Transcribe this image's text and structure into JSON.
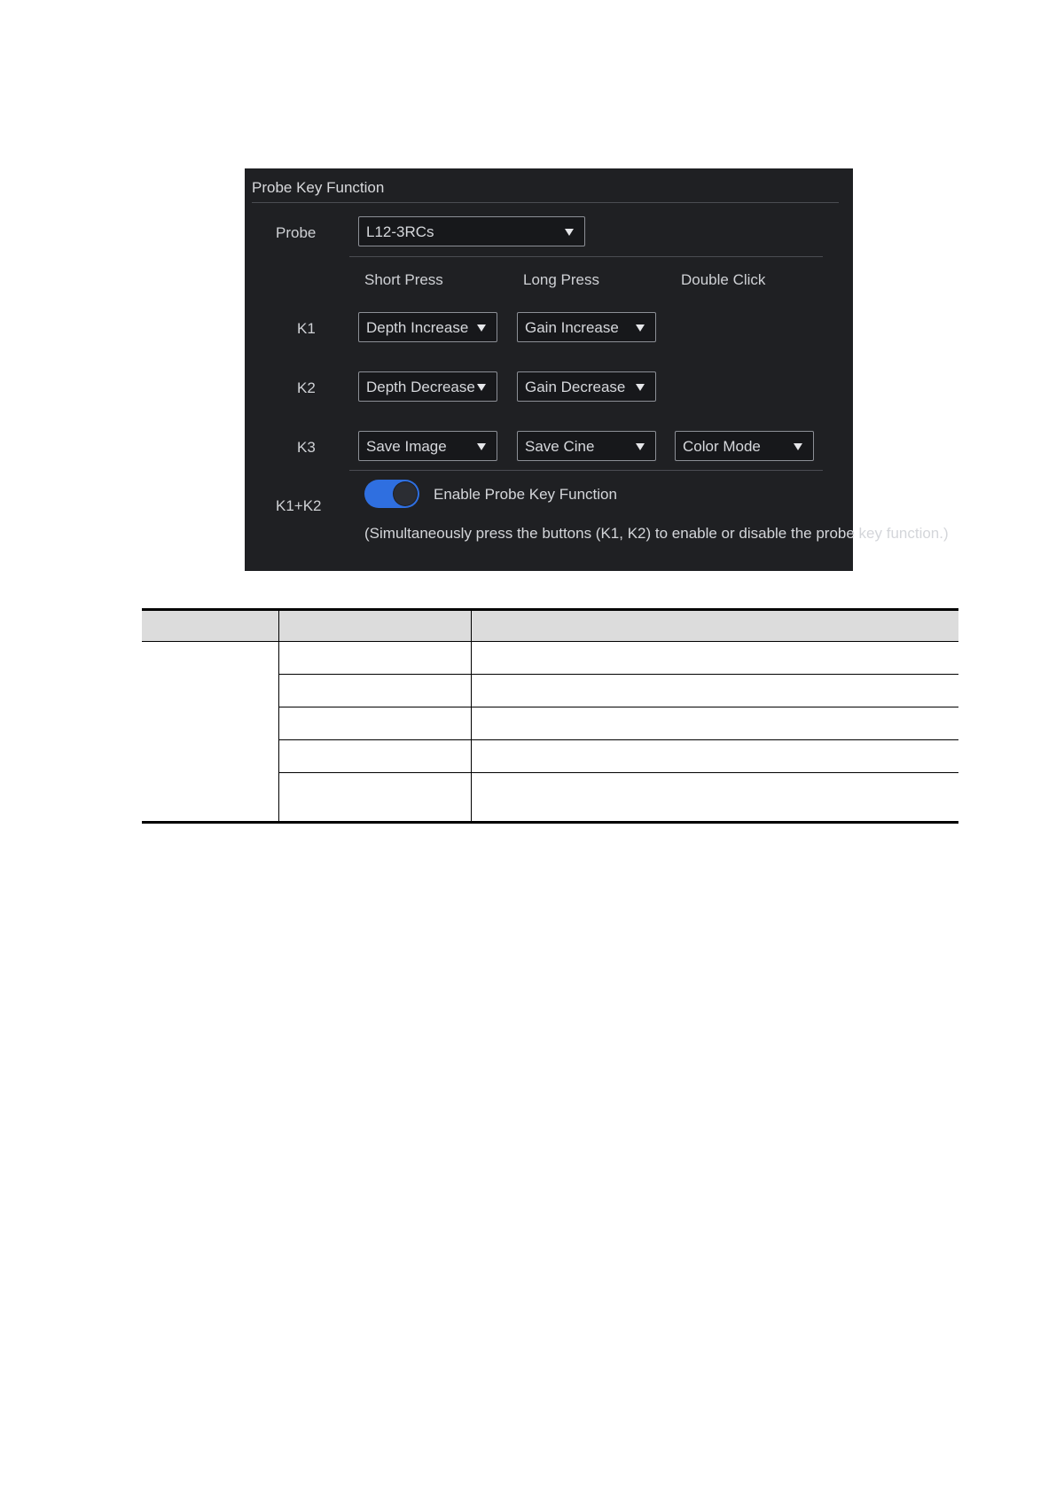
{
  "panel": {
    "title": "Probe Key Function",
    "probe": {
      "label": "Probe",
      "value": "L12-3RCs"
    },
    "columns": {
      "short": "Short Press",
      "long": "Long Press",
      "double": "Double Click"
    },
    "rows": [
      {
        "key": "K1",
        "short": "Depth Increase",
        "long": "Gain Increase"
      },
      {
        "key": "K2",
        "short": "Depth Decrease",
        "long": "Gain Decrease"
      },
      {
        "key": "K3",
        "short": "Save Image",
        "long": "Save Cine",
        "double": "Color Mode"
      }
    ],
    "combo": {
      "key": "K1+K2",
      "toggle_label": "Enable Probe Key Function",
      "toggle_on": true,
      "note": "(Simultaneously press the buttons (K1, K2) to enable or disable the probe key function.)"
    },
    "colors": {
      "background": "#1f2023",
      "toggle": "#2f6fe0"
    }
  }
}
